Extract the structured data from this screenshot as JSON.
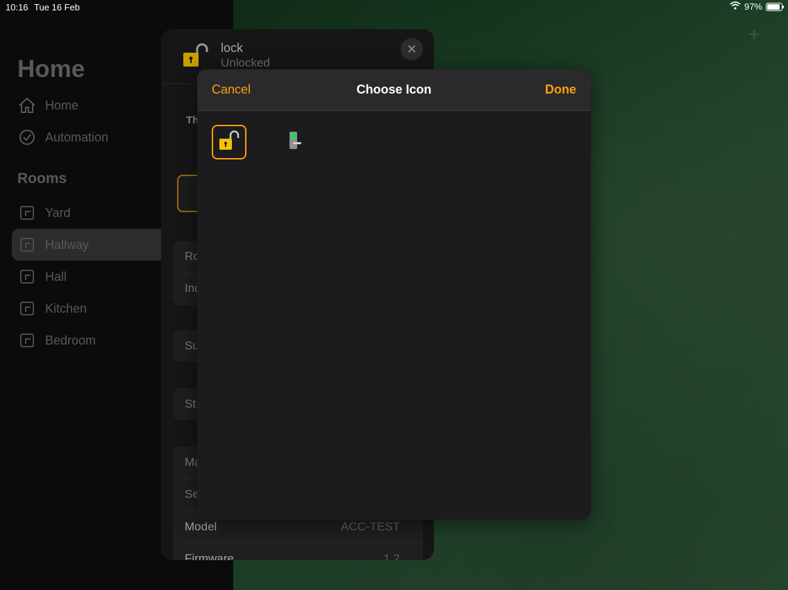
{
  "status_bar": {
    "time": "10:16",
    "date": "Tue 16 Feb",
    "battery": "97%",
    "battery_level": 0.97
  },
  "sidebar": {
    "title": "Home",
    "nav": [
      {
        "label": "Home",
        "icon": "house-icon"
      },
      {
        "label": "Automation",
        "icon": "clock-icon"
      }
    ],
    "rooms_title": "Rooms",
    "rooms": [
      {
        "label": "Yard"
      },
      {
        "label": "Hallway",
        "selected": true
      },
      {
        "label": "Hall"
      },
      {
        "label": "Kitchen"
      },
      {
        "label": "Bedroom"
      }
    ]
  },
  "accessory": {
    "name": "lock",
    "status": "Unlocked",
    "peek_label": "Th",
    "rows": [
      {
        "label": "Ro"
      },
      {
        "label": "Inc"
      },
      {
        "label": "Su"
      },
      {
        "label": "St"
      },
      {
        "label": "Ma"
      },
      {
        "label": "Se"
      },
      {
        "label": "Model",
        "value": "ACC-TEST"
      },
      {
        "label": "Firmware",
        "value": "1.2"
      }
    ]
  },
  "modal": {
    "title": "Choose Icon",
    "cancel": "Cancel",
    "done": "Done",
    "icons": [
      {
        "name": "padlock-open-icon",
        "selected": true
      },
      {
        "name": "smart-lock-icon",
        "selected": false
      }
    ]
  },
  "colors": {
    "accent": "#ff9f0a",
    "lock_yellow": "#f5c300",
    "modal_bg": "#1c1c1e"
  }
}
